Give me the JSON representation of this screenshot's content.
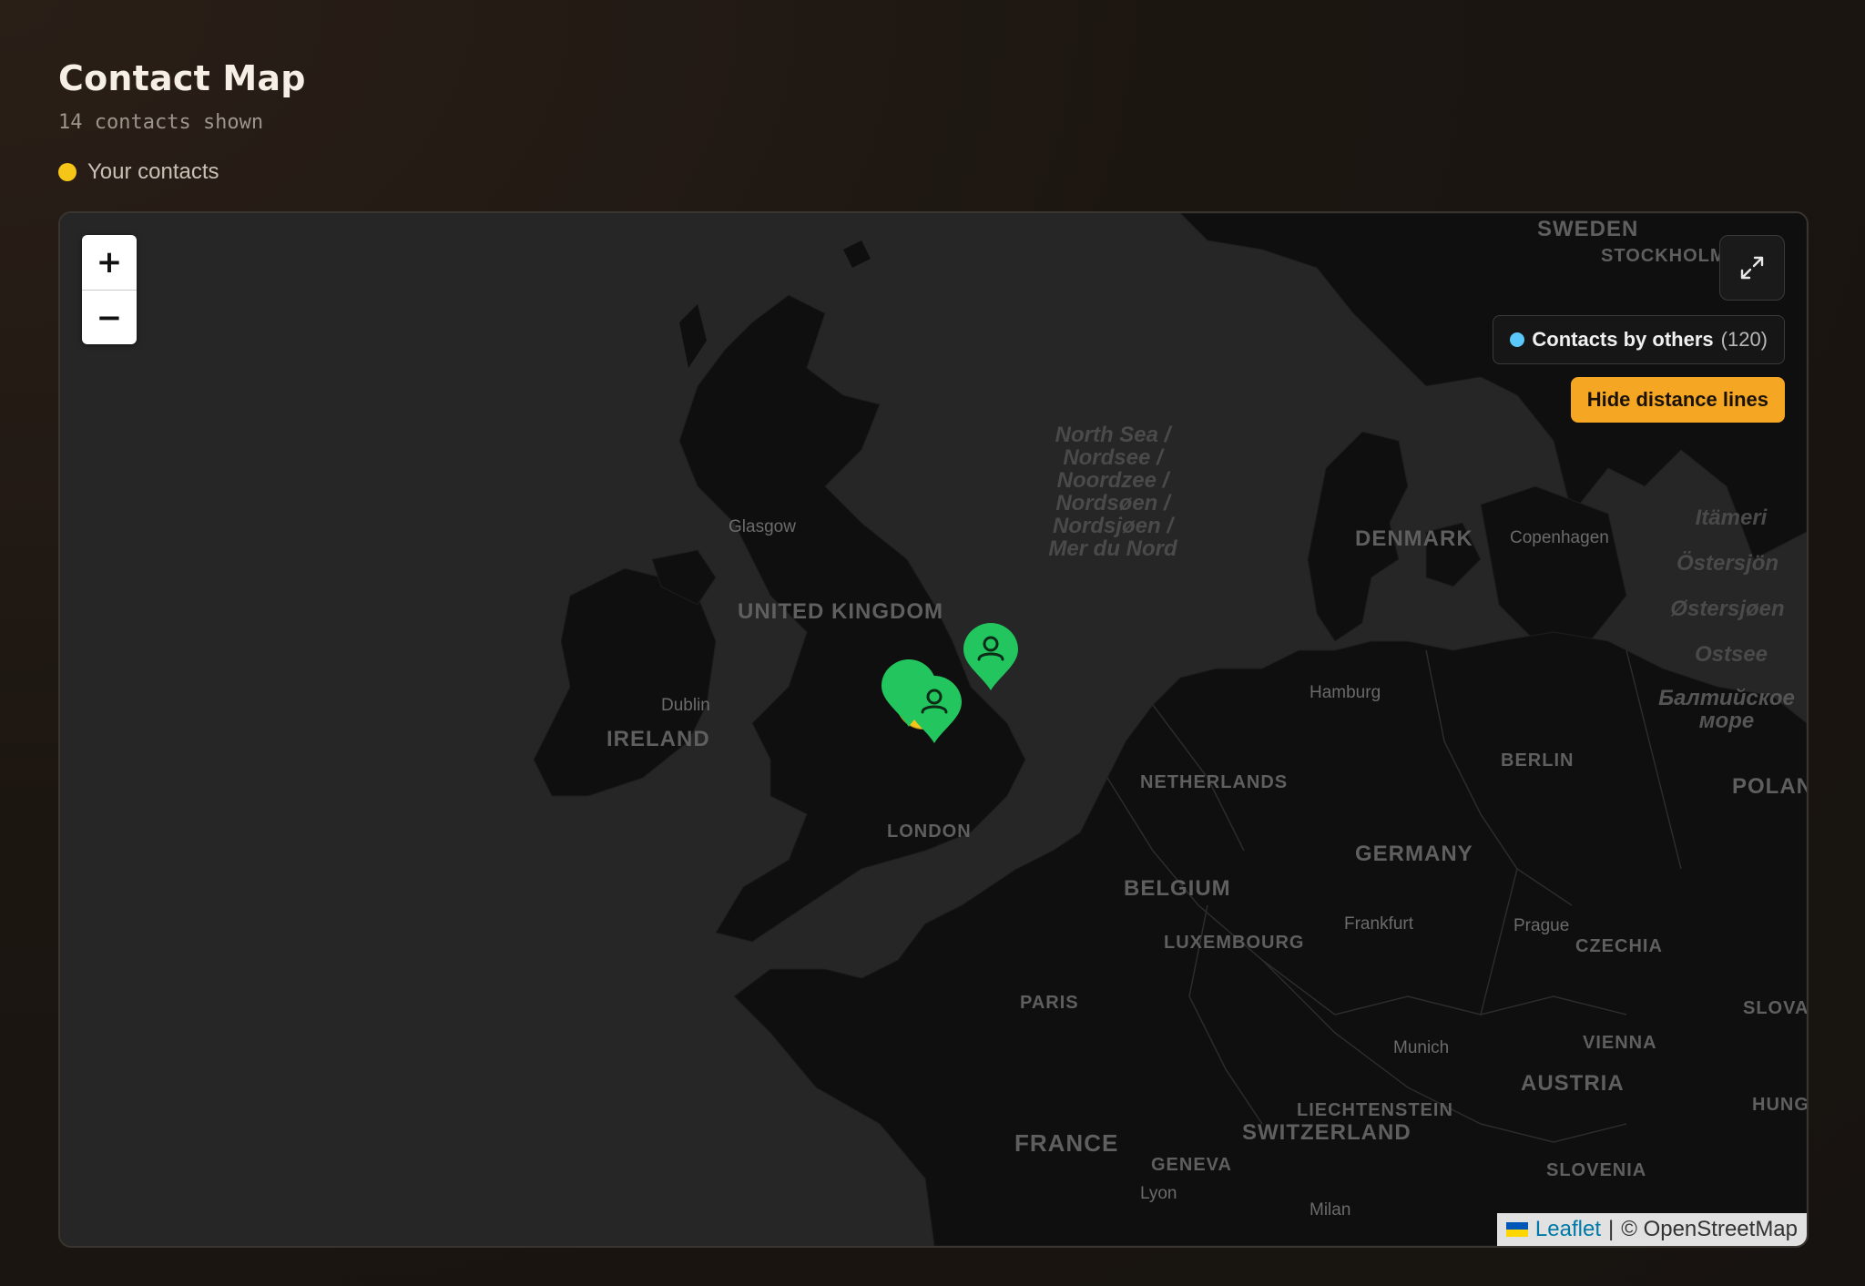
{
  "header": {
    "title": "Contact Map",
    "subtitle": "14 contacts shown",
    "legend_label": "Your contacts",
    "legend_color": "#f5c518"
  },
  "map": {
    "controls": {
      "zoom_in": "+",
      "zoom_out": "−",
      "fullscreen_icon": "expand-icon"
    },
    "others_toggle": {
      "label": "Contacts by others",
      "count": "(120)",
      "color": "#5ac8fa"
    },
    "distance_button": "Hide distance lines",
    "labels": {
      "sweden": "SWEDEN",
      "stockholm": "STOCKHOLM",
      "north_sea": "North Sea / Nordsee / Noordzee / Nordsøen / Nordsjøen / Mer du Nord",
      "glasgow": "Glasgow",
      "denmark": "DENMARK",
      "copenhagen": "Copenhagen",
      "united_kingdom": "UNITED KINGDOM",
      "dublin": "Dublin",
      "ireland": "IRELAND",
      "hamburg": "Hamburg",
      "berlin": "BERLIN",
      "netherlands": "NETHERLANDS",
      "london": "LONDON",
      "germany": "GERMANY",
      "belgium": "BELGIUM",
      "frankfurt": "Frankfurt",
      "prague": "Prague",
      "luxembourg": "LUXEMBOURG",
      "czechia": "CZECHIA",
      "paris": "PARIS",
      "munich": "Munich",
      "vienna": "VIENNA",
      "austria": "AUSTRIA",
      "liechtenstein": "LIECHTENSTEIN",
      "switzerland": "SWITZERLAND",
      "france": "FRANCE",
      "geneva": "GENEVA",
      "lyon": "Lyon",
      "milan": "Milan",
      "slovenia": "SLOVENIA",
      "baltic_fi": "Itämeri",
      "baltic_sv": "Östersjön",
      "baltic_no": "Østersjøen",
      "baltic_de": "Ostsee",
      "baltic_ru": "Балтийское море",
      "poland": "POLAND",
      "slovakia": "SLOVAKIA",
      "hungary": "HUNGARY"
    },
    "attribution": {
      "leaflet": "Leaflet",
      "separator": "|",
      "osm": "© OpenStreetMap"
    }
  },
  "markers": [
    {
      "type": "your-contact",
      "color": "#f5c518",
      "place": "Midlands"
    },
    {
      "type": "contact",
      "color": "#22c55e",
      "place": "Manchester area"
    },
    {
      "type": "contact",
      "color": "#22c55e",
      "place": "Midlands"
    },
    {
      "type": "contact",
      "color": "#22c55e",
      "place": "Yorkshire"
    }
  ]
}
